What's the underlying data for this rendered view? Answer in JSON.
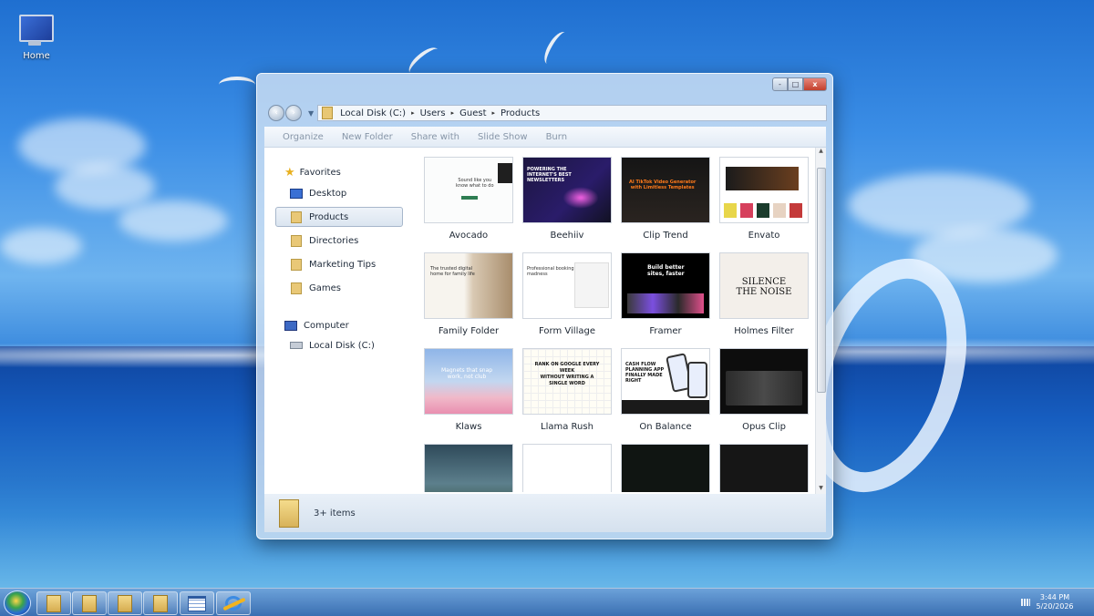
{
  "desktop": {
    "icon_label": "Home"
  },
  "window": {
    "controls": {
      "minimize": "-",
      "maximize": "□",
      "close": "x"
    },
    "nav": {
      "back": "‹",
      "forward": "›",
      "dropdown": "▼"
    },
    "breadcrumb": [
      "Local Disk (C:)",
      "Users",
      "Guest",
      "Products"
    ],
    "breadcrumb_sep": "▸",
    "toolbar": [
      "Organize",
      "New Folder",
      "Share with",
      "Slide Show",
      "Burn"
    ],
    "sidebar": {
      "favorites_label": "Favorites",
      "favorites": [
        "Desktop",
        "Products",
        "Directories",
        "Marketing Tips",
        "Games"
      ],
      "selected": "Products",
      "computer_label": "Computer",
      "computer": [
        "Local Disk (C:)"
      ]
    },
    "items": [
      "Avocado",
      "Beehiiv",
      "Clip Trend",
      "Envato",
      "Family Folder",
      "Form Village",
      "Framer",
      "Holmes Filter",
      "Klaws",
      "Llama Rush",
      "On Balance",
      "Opus Clip",
      "",
      "",
      "",
      ""
    ],
    "thumbnail_text": {
      "avocado": "Sound like you\nknow what to do",
      "beehiiv": "POWERING THE\nINTERNET'S BEST\nNEWSLETTERS",
      "cliptrend": "AI TikTok Video Generator\nwith Limitless Templates",
      "framer": "Build better\nsites, faster",
      "holmes": "SILENCE\nTHE NOISE",
      "klaws": "Magnets that snap\nwork, not club",
      "llama": "RANK ON GOOGLE EVERY\nWEEK\nWITHOUT WRITING A\nSINGLE WORD",
      "onbalance": "CASH FLOW\nPLANNING APP\nFINALLY MADE\nRIGHT",
      "family": "The trusted digital\nhome for family life",
      "form": "Professional booking\nmadness"
    },
    "status_text": "3+ items"
  },
  "taskbar": {
    "time": "3:44 PM",
    "date": "5/20/2026"
  }
}
